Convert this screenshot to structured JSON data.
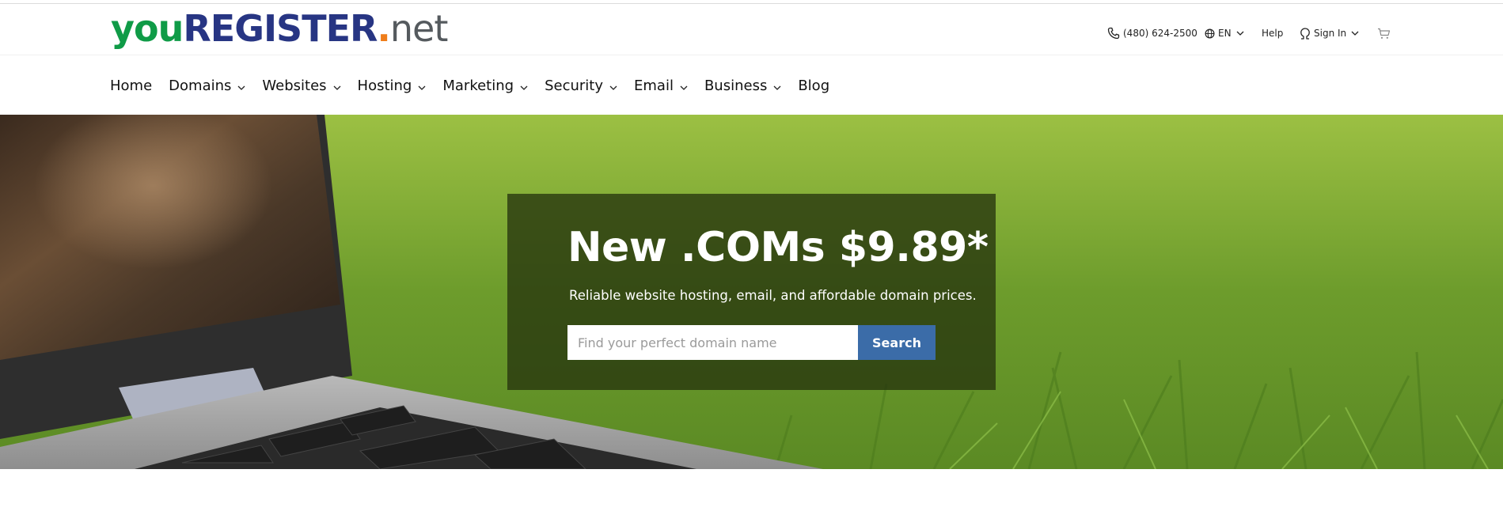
{
  "brand": {
    "logo_part1": "you",
    "logo_part2": "REGISTER",
    "logo_dot": ".",
    "logo_part3": "net",
    "colors": {
      "green": "#0f9b47",
      "navy": "#273583",
      "orange": "#ef7d1a",
      "gray": "#555a5e"
    }
  },
  "utility_bar": {
    "phone": "(480) 624-2500",
    "language": "EN",
    "help": "Help",
    "sign_in": "Sign In",
    "icons": {
      "phone": "phone-icon",
      "language": "globe-icon",
      "sign_in": "user-icon",
      "cart": "cart-icon"
    }
  },
  "nav": {
    "items": [
      {
        "label": "Home",
        "dropdown": false
      },
      {
        "label": "Domains",
        "dropdown": true
      },
      {
        "label": "Websites",
        "dropdown": true
      },
      {
        "label": "Hosting",
        "dropdown": true
      },
      {
        "label": "Marketing",
        "dropdown": true
      },
      {
        "label": "Security",
        "dropdown": true
      },
      {
        "label": "Email",
        "dropdown": true
      },
      {
        "label": "Business",
        "dropdown": true
      },
      {
        "label": "Blog",
        "dropdown": false
      }
    ]
  },
  "hero": {
    "title": "New .COMs $9.89*",
    "subtitle": "Reliable website hosting, email, and affordable domain prices.",
    "search": {
      "placeholder": "Find your perfect domain name",
      "value": "",
      "button_label": "Search"
    },
    "colors": {
      "button": "#3b6ca8",
      "overlay": "#26340e"
    }
  }
}
